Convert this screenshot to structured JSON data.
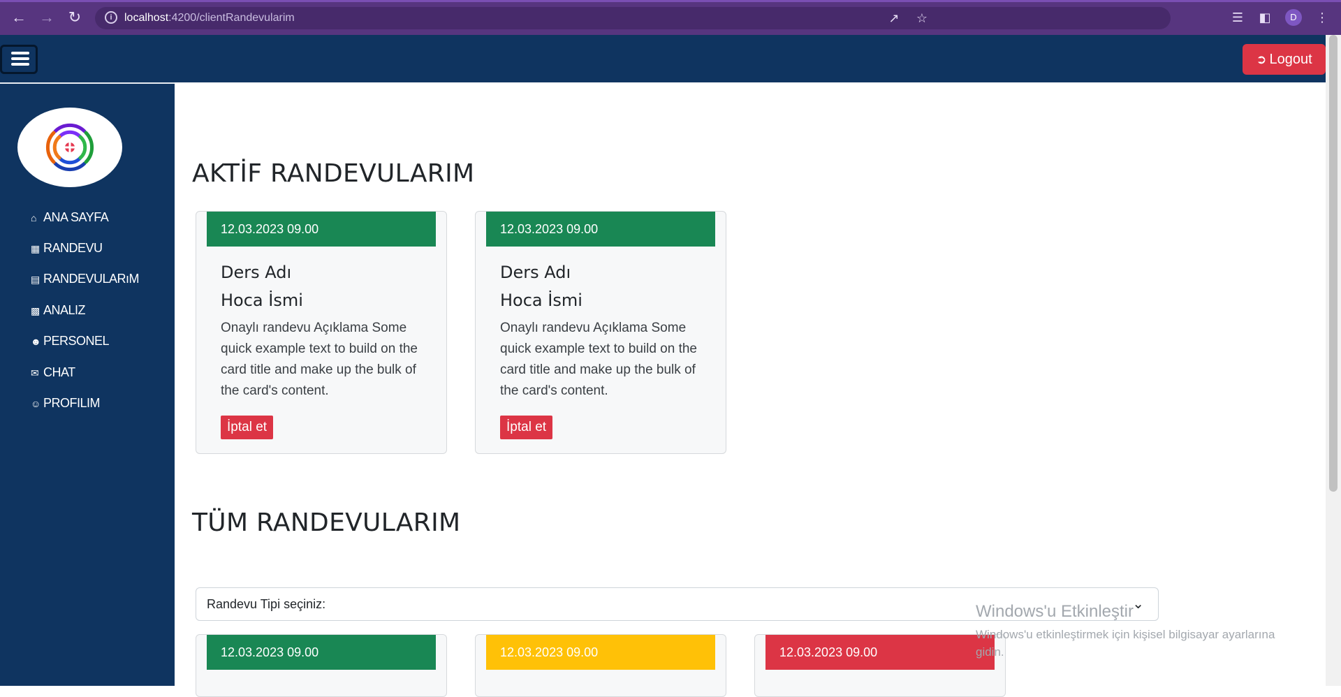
{
  "browser": {
    "url_host": "localhost",
    "url_path": ":4200/clientRandevularim",
    "profile_initial": "D"
  },
  "topbar": {
    "logout_label": "Logout"
  },
  "sidebar": {
    "items": [
      {
        "label": "ANA SAYFA",
        "icon": "home-icon"
      },
      {
        "label": "RANDEVU",
        "icon": "calendar-icon"
      },
      {
        "label": "RANDEVULARıM",
        "icon": "list-icon"
      },
      {
        "label": "ANALIZ",
        "icon": "chart-icon"
      },
      {
        "label": "PERSONEL",
        "icon": "users-icon"
      },
      {
        "label": "CHAT",
        "icon": "chat-icon"
      },
      {
        "label": "PROFILIM",
        "icon": "user-icon"
      }
    ]
  },
  "active_section": {
    "title": "AKTİF RANDEVULARIM",
    "cards": [
      {
        "date": "12.03.2023 09.00",
        "course": "Ders Adı",
        "teacher": "Hoca İsmi",
        "text": "Onaylı randevu Açıklama Some quick example text to build on the card title and make up the bulk of the card's content.",
        "cancel": "İptal et",
        "status_color": "#198754"
      },
      {
        "date": "12.03.2023 09.00",
        "course": "Ders Adı",
        "teacher": "Hoca İsmi",
        "text": "Onaylı randevu Açıklama Some quick example text to build on the card title and make up the bulk of the card's content.",
        "cancel": "İptal et",
        "status_color": "#198754"
      }
    ]
  },
  "all_section": {
    "title": "TÜM RANDEVULARIM",
    "select_value": "Randevu Tipi seçiniz:",
    "cards": [
      {
        "date": "12.03.2023 09.00",
        "status_color": "#198754"
      },
      {
        "date": "12.03.2023 09.00",
        "status_color": "#ffc107"
      },
      {
        "date": "12.03.2023 09.00",
        "status_color": "#dc3545"
      }
    ]
  },
  "watermark": {
    "title": "Windows'u Etkinleştir",
    "text": "Windows'u etkinleştirmek için kişisel bilgisayar ayarlarına gidin."
  },
  "colors": {
    "brand_navy": "#0f3460",
    "danger": "#dc3545",
    "success": "#198754",
    "warning": "#ffc107"
  }
}
